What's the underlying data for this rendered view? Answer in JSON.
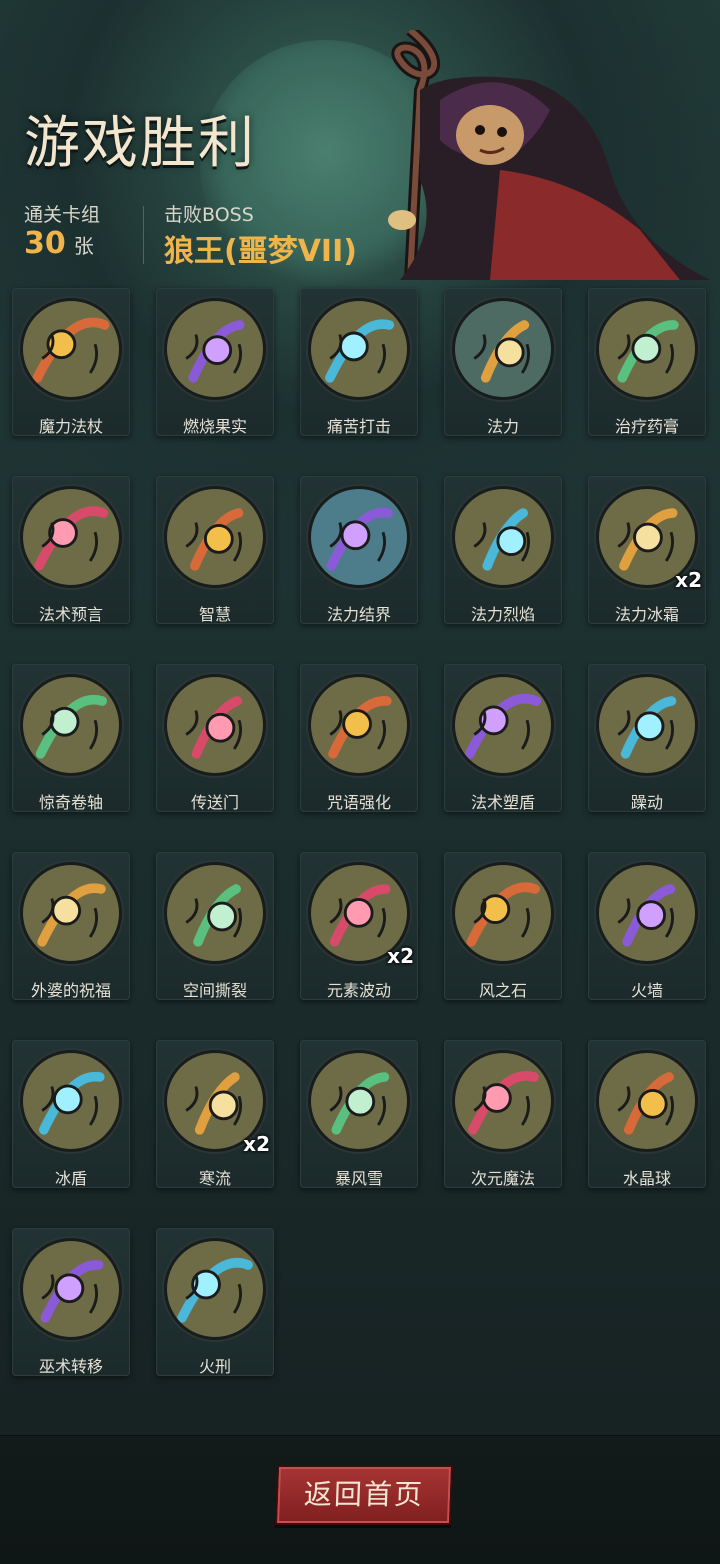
{
  "header": {
    "title": "游戏胜利",
    "deck_label": "通关卡组",
    "deck_count": "30",
    "deck_unit": "张",
    "boss_label": "击败BOSS",
    "boss_name": "狼王(噩梦VII)"
  },
  "cards": [
    {
      "name": "魔力法杖",
      "count": "",
      "icon": "staff-icon",
      "bg": "#6e6c47"
    },
    {
      "name": "燃烧果实",
      "count": "",
      "icon": "burning-fruit-icon",
      "bg": "#6e6c47"
    },
    {
      "name": "痛苦打击",
      "count": "",
      "icon": "pain-strike-icon",
      "bg": "#6e6c47"
    },
    {
      "name": "法力",
      "count": "",
      "icon": "mana-icon",
      "bg": "#4e6b63"
    },
    {
      "name": "治疗药膏",
      "count": "",
      "icon": "healing-ointment-icon",
      "bg": "#6e6c47"
    },
    {
      "name": "法术预言",
      "count": "",
      "icon": "prophecy-orb-icon",
      "bg": "#6e6c47"
    },
    {
      "name": "智慧",
      "count": "",
      "icon": "wisdom-sage-icon",
      "bg": "#6e6c47"
    },
    {
      "name": "法力结界",
      "count": "",
      "icon": "mana-barrier-icon",
      "bg": "#4d7d8a"
    },
    {
      "name": "法力烈焰",
      "count": "",
      "icon": "mana-flame-icon",
      "bg": "#6e6c47"
    },
    {
      "name": "法力冰霜",
      "count": "x2",
      "icon": "mana-frost-icon",
      "bg": "#6e6c47"
    },
    {
      "name": "惊奇卷轴",
      "count": "",
      "icon": "scroll-icon",
      "bg": "#6e6c47"
    },
    {
      "name": "传送门",
      "count": "",
      "icon": "portal-icon",
      "bg": "#6e6c47"
    },
    {
      "name": "咒语强化",
      "count": "",
      "icon": "spell-empower-icon",
      "bg": "#6e6c47"
    },
    {
      "name": "法术塑盾",
      "count": "",
      "icon": "spell-shield-icon",
      "bg": "#6e6c47"
    },
    {
      "name": "躁动",
      "count": "",
      "icon": "frenzy-icon",
      "bg": "#6e6c47"
    },
    {
      "name": "外婆的祝福",
      "count": "",
      "icon": "grandma-blessing-icon",
      "bg": "#6e6c47"
    },
    {
      "name": "空间撕裂",
      "count": "",
      "icon": "space-rift-icon",
      "bg": "#6e6c47"
    },
    {
      "name": "元素波动",
      "count": "x2",
      "icon": "element-wave-icon",
      "bg": "#6e6c47"
    },
    {
      "name": "风之石",
      "count": "",
      "icon": "wind-stone-icon",
      "bg": "#6e6c47"
    },
    {
      "name": "火墙",
      "count": "",
      "icon": "fire-wall-icon",
      "bg": "#6e6c47"
    },
    {
      "name": "冰盾",
      "count": "",
      "icon": "ice-shield-icon",
      "bg": "#6e6c47"
    },
    {
      "name": "寒流",
      "count": "x2",
      "icon": "cold-current-icon",
      "bg": "#6e6c47"
    },
    {
      "name": "暴风雪",
      "count": "",
      "icon": "blizzard-icon",
      "bg": "#6e6c47"
    },
    {
      "name": "次元魔法",
      "count": "",
      "icon": "dimension-magic-icon",
      "bg": "#6e6c47"
    },
    {
      "name": "水晶球",
      "count": "",
      "icon": "crystal-ball-icon",
      "bg": "#6e6c47"
    },
    {
      "name": "巫术转移",
      "count": "",
      "icon": "witchcraft-transfer-icon",
      "bg": "#6e6c47"
    },
    {
      "name": "火刑",
      "count": "",
      "icon": "burning-stake-icon",
      "bg": "#6e6c47"
    }
  ],
  "footer": {
    "return_label": "返回首页"
  }
}
